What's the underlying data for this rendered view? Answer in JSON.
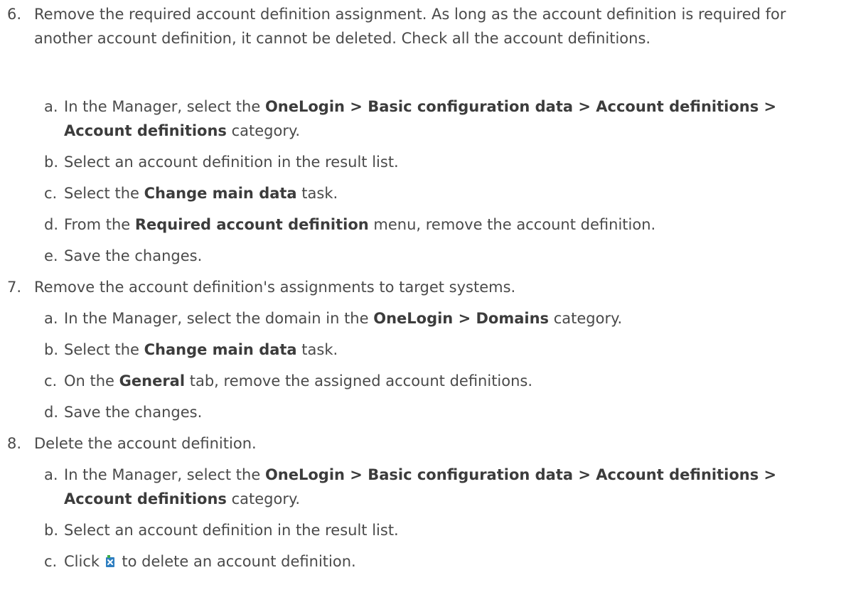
{
  "steps": [
    {
      "num": "6.",
      "text": "Remove the required account definition assignment. As long as the account definition is required for another account definition, it cannot be deleted. Check all the account definitions.",
      "subs": [
        {
          "letter": "a.",
          "pre": "In the Manager, select the ",
          "bold": "OneLogin > Basic configuration data > Account definitions > Account definitions",
          "post": " category."
        },
        {
          "letter": "b.",
          "pre": "Select an account definition in the result list.",
          "bold": "",
          "post": ""
        },
        {
          "letter": "c.",
          "pre": "Select the ",
          "bold": "Change main data",
          "post": " task."
        },
        {
          "letter": "d.",
          "pre": "From the ",
          "bold": "Required account definition",
          "post": " menu, remove the account definition."
        },
        {
          "letter": "e.",
          "pre": "Save the changes.",
          "bold": "",
          "post": ""
        }
      ]
    },
    {
      "num": "7.",
      "text": "Remove the account definition's assignments to target systems.",
      "subs": [
        {
          "letter": "a.",
          "pre": "In the Manager, select the domain in the ",
          "bold": "OneLogin > Domains",
          "post": " category."
        },
        {
          "letter": "b.",
          "pre": "Select the ",
          "bold": "Change main data",
          "post": " task."
        },
        {
          "letter": "c.",
          "pre": "On the ",
          "bold": "General",
          "post": " tab, remove the assigned account definitions."
        },
        {
          "letter": "d.",
          "pre": "Save the changes.",
          "bold": "",
          "post": ""
        }
      ]
    },
    {
      "num": "8.",
      "text": "Delete the account definition.",
      "subs": [
        {
          "letter": "a.",
          "pre": "In the Manager, select the ",
          "bold": "OneLogin > Basic configuration data > Account definitions > Account definitions",
          "post": " category."
        },
        {
          "letter": "b.",
          "pre": "Select an account definition in the result list.",
          "bold": "",
          "post": ""
        },
        {
          "letter": "c.",
          "pre": "Click ",
          "icon": "delete-icon",
          "post": " to delete an account definition."
        }
      ]
    }
  ],
  "colors": {
    "text": "#4a4a4a",
    "icon_blue": "#2f7fc1",
    "icon_green": "#3fae49"
  }
}
